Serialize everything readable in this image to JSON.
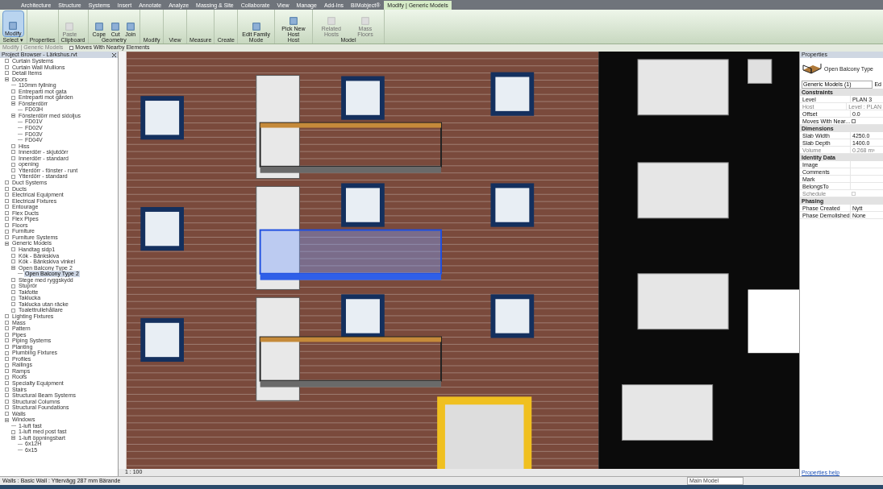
{
  "ribbon_tabs": [
    {
      "label": "Architecture",
      "selected": false
    },
    {
      "label": "Structure",
      "selected": false
    },
    {
      "label": "Systems",
      "selected": false
    },
    {
      "label": "Insert",
      "selected": false
    },
    {
      "label": "Annotate",
      "selected": false
    },
    {
      "label": "Analyze",
      "selected": false
    },
    {
      "label": "Massing & Site",
      "selected": false
    },
    {
      "label": "Collaborate",
      "selected": false
    },
    {
      "label": "View",
      "selected": false
    },
    {
      "label": "Manage",
      "selected": false
    },
    {
      "label": "Add-Ins",
      "selected": false
    },
    {
      "label": "BIMobject®",
      "selected": false
    },
    {
      "label": "Modify | Generic Models",
      "selected": true
    }
  ],
  "ribbon_panels": [
    {
      "label": "Select ▾",
      "tools": [
        {
          "label": "Modify",
          "selected": true,
          "disabled": false
        }
      ]
    },
    {
      "label": "Properties"
    },
    {
      "label": "Clipboard",
      "tools": [
        {
          "label": "Paste",
          "selected": false,
          "disabled": true
        }
      ]
    },
    {
      "label": "Geometry",
      "tools": [
        {
          "label": "Cope",
          "selected": false,
          "disabled": false
        },
        {
          "label": "Cut",
          "selected": false,
          "disabled": false
        },
        {
          "label": "Join",
          "selected": false,
          "disabled": false
        }
      ]
    },
    {
      "label": "Modify"
    },
    {
      "label": "View"
    },
    {
      "label": "Measure"
    },
    {
      "label": "Create"
    },
    {
      "label": "Mode",
      "tools": [
        {
          "label": "Edit Family",
          "selected": false,
          "disabled": false
        }
      ]
    },
    {
      "label": "Host",
      "tools": [
        {
          "label": "Pick New Host",
          "selected": false,
          "disabled": false
        }
      ]
    },
    {
      "label": "Model",
      "tools": [
        {
          "label": "Related Hosts",
          "selected": false,
          "disabled": true
        },
        {
          "label": "Mass Floors",
          "selected": false,
          "disabled": true
        }
      ]
    }
  ],
  "options_bar": {
    "context": "Modify | Generic Models",
    "checkbox": {
      "label": "Moves With Nearby Elements",
      "checked": false
    }
  },
  "project_browser": {
    "title": "Project Browser - Lärkshus.rvt",
    "items": [
      {
        "label": "Curtain Systems",
        "kind": "folder",
        "expanded": false,
        "selected": false
      },
      {
        "label": "Curtain Wall Mullions",
        "kind": "folder",
        "expanded": false,
        "selected": false
      },
      {
        "label": "Detail Items",
        "kind": "folder",
        "expanded": false,
        "selected": false
      },
      {
        "label": "Doors",
        "kind": "folder",
        "expanded": true,
        "selected": false,
        "children": [
          {
            "label": "110mm fyllning",
            "kind": "leaf",
            "selected": false
          },
          {
            "label": "Entreparti mot gata",
            "kind": "folder",
            "expanded": false,
            "selected": false
          },
          {
            "label": "Entreparti mot gården",
            "kind": "folder",
            "expanded": false,
            "selected": false
          },
          {
            "label": "Fönsterdörr",
            "kind": "folder",
            "expanded": true,
            "selected": false,
            "children": [
              {
                "label": "FD03H",
                "kind": "leaf",
                "selected": false
              }
            ]
          },
          {
            "label": "Fönsterdörr med sidoljus",
            "kind": "folder",
            "expanded": true,
            "selected": false,
            "children": [
              {
                "label": "FD01V",
                "kind": "leaf",
                "selected": false
              },
              {
                "label": "FD02V",
                "kind": "leaf",
                "selected": false
              },
              {
                "label": "FD03V",
                "kind": "leaf",
                "selected": false
              },
              {
                "label": "FD04V",
                "kind": "leaf",
                "selected": false
              }
            ]
          },
          {
            "label": "Hiss",
            "kind": "folder",
            "expanded": false,
            "selected": false
          },
          {
            "label": "Innerdörr - skjutdörr",
            "kind": "folder",
            "expanded": false,
            "selected": false
          },
          {
            "label": "Innerdörr - standard",
            "kind": "folder",
            "expanded": false,
            "selected": false
          },
          {
            "label": "opening",
            "kind": "folder",
            "expanded": false,
            "selected": false
          },
          {
            "label": "Ytterdörr - fönster - runt",
            "kind": "folder",
            "expanded": false,
            "selected": false
          },
          {
            "label": "Ytterdörr - standard",
            "kind": "folder",
            "expanded": false,
            "selected": false
          }
        ]
      },
      {
        "label": "Duct Systems",
        "kind": "folder",
        "expanded": false,
        "selected": false
      },
      {
        "label": "Ducts",
        "kind": "folder",
        "expanded": false,
        "selected": false
      },
      {
        "label": "Electrical Equipment",
        "kind": "folder",
        "expanded": false,
        "selected": false
      },
      {
        "label": "Electrical Fixtures",
        "kind": "folder",
        "expanded": false,
        "selected": false
      },
      {
        "label": "Entourage",
        "kind": "folder",
        "expanded": false,
        "selected": false
      },
      {
        "label": "Flex Ducts",
        "kind": "folder",
        "expanded": false,
        "selected": false
      },
      {
        "label": "Flex Pipes",
        "kind": "folder",
        "expanded": false,
        "selected": false
      },
      {
        "label": "Floors",
        "kind": "folder",
        "expanded": false,
        "selected": false
      },
      {
        "label": "Furniture",
        "kind": "folder",
        "expanded": false,
        "selected": false
      },
      {
        "label": "Furniture Systems",
        "kind": "folder",
        "expanded": false,
        "selected": false
      },
      {
        "label": "Generic Models",
        "kind": "folder",
        "expanded": true,
        "selected": false,
        "children": [
          {
            "label": "Handtag sidp1",
            "kind": "folder",
            "expanded": false,
            "selected": false
          },
          {
            "label": "Kök - Bänkskiva",
            "kind": "folder",
            "expanded": false,
            "selected": false
          },
          {
            "label": "Kök - Bänkskiva vinkel",
            "kind": "folder",
            "expanded": false,
            "selected": false
          },
          {
            "label": "Open Balcony Type 2",
            "kind": "folder",
            "expanded": true,
            "selected": false,
            "children": [
              {
                "label": "Open Balcony Type 2",
                "kind": "leaf",
                "selected": true
              }
            ]
          },
          {
            "label": "Stege med ryggskydd",
            "kind": "folder",
            "expanded": false,
            "selected": false
          },
          {
            "label": "Stuprör",
            "kind": "folder",
            "expanded": false,
            "selected": false
          },
          {
            "label": "Takfotte",
            "kind": "folder",
            "expanded": false,
            "selected": false
          },
          {
            "label": "Taklucka",
            "kind": "folder",
            "expanded": false,
            "selected": false
          },
          {
            "label": "Taklucka utan räcke",
            "kind": "folder",
            "expanded": false,
            "selected": false
          },
          {
            "label": "Toalettrullehållare",
            "kind": "folder",
            "expanded": false,
            "selected": false
          }
        ]
      },
      {
        "label": "Lighting Fixtures",
        "kind": "folder",
        "expanded": false,
        "selected": false
      },
      {
        "label": "Mass",
        "kind": "folder",
        "expanded": false,
        "selected": false
      },
      {
        "label": "Pattern",
        "kind": "folder",
        "expanded": false,
        "selected": false
      },
      {
        "label": "Pipes",
        "kind": "folder",
        "expanded": false,
        "selected": false
      },
      {
        "label": "Piping Systems",
        "kind": "folder",
        "expanded": false,
        "selected": false
      },
      {
        "label": "Planting",
        "kind": "folder",
        "expanded": false,
        "selected": false
      },
      {
        "label": "Plumbing Fixtures",
        "kind": "folder",
        "expanded": false,
        "selected": false
      },
      {
        "label": "Profiles",
        "kind": "folder",
        "expanded": false,
        "selected": false
      },
      {
        "label": "Railings",
        "kind": "folder",
        "expanded": false,
        "selected": false
      },
      {
        "label": "Ramps",
        "kind": "folder",
        "expanded": false,
        "selected": false
      },
      {
        "label": "Roofs",
        "kind": "folder",
        "expanded": false,
        "selected": false
      },
      {
        "label": "Specialty Equipment",
        "kind": "folder",
        "expanded": false,
        "selected": false
      },
      {
        "label": "Stairs",
        "kind": "folder",
        "expanded": false,
        "selected": false
      },
      {
        "label": "Structural Beam Systems",
        "kind": "folder",
        "expanded": false,
        "selected": false
      },
      {
        "label": "Structural Columns",
        "kind": "folder",
        "expanded": false,
        "selected": false
      },
      {
        "label": "Structural Foundations",
        "kind": "folder",
        "expanded": false,
        "selected": false
      },
      {
        "label": "Walls",
        "kind": "folder",
        "expanded": false,
        "selected": false
      },
      {
        "label": "Windows",
        "kind": "folder",
        "expanded": true,
        "selected": false,
        "children": [
          {
            "label": "1-luft fast",
            "kind": "leaf",
            "selected": false
          },
          {
            "label": "1-luft med post fast",
            "kind": "folder",
            "expanded": false,
            "selected": false
          },
          {
            "label": "1-luft öppningsbart",
            "kind": "folder",
            "expanded": true,
            "selected": false,
            "children": [
              {
                "label": "6x12H",
                "kind": "leaf",
                "selected": false
              },
              {
                "label": "6x15",
                "kind": "leaf",
                "selected": false
              }
            ]
          }
        ]
      }
    ]
  },
  "view": {
    "scale": "1 : 100"
  },
  "properties": {
    "title": "Properties",
    "type_name": "Open Balcony Type",
    "selector": "Generic Models (1)",
    "edit_type": "Ed",
    "sections": [
      {
        "title": "Constraints",
        "rows": [
          {
            "label": "Level",
            "value": "PLAN 3",
            "kind": "text",
            "disabled": false
          },
          {
            "label": "Host",
            "value": "Level : PLAN",
            "kind": "text",
            "disabled": true
          },
          {
            "label": "Offset",
            "value": "0.0",
            "kind": "text",
            "disabled": false
          },
          {
            "label": "Moves With Near...",
            "kind": "checkbox",
            "checked": false,
            "disabled": false
          }
        ]
      },
      {
        "title": "Dimensions",
        "rows": [
          {
            "label": "Slab Width",
            "value": "4250.0",
            "kind": "text",
            "disabled": false
          },
          {
            "label": "Slab Depth",
            "value": "1400.0",
            "kind": "text",
            "disabled": false
          },
          {
            "label": "Volume",
            "value": "0.268 m³",
            "kind": "text",
            "disabled": true
          }
        ]
      },
      {
        "title": "Identity Data",
        "rows": [
          {
            "label": "Image",
            "kind": "text",
            "disabled": false
          },
          {
            "label": "Comments",
            "kind": "text",
            "disabled": false
          },
          {
            "label": "Mark",
            "kind": "text",
            "disabled": false
          },
          {
            "label": "BelongsTo",
            "kind": "text",
            "disabled": false
          },
          {
            "label": "Schedule",
            "kind": "checkbox",
            "checked": false,
            "disabled": true
          }
        ]
      },
      {
        "title": "Phasing",
        "rows": [
          {
            "label": "Phase Created",
            "value": "Nytt",
            "kind": "text",
            "disabled": false
          },
          {
            "label": "Phase Demolished",
            "value": "None",
            "kind": "text",
            "disabled": false
          }
        ]
      }
    ],
    "help_link": "Properties help"
  },
  "status_bar": {
    "message": "Walls : Basic Wall : Yttervägg 287 mm Bärande",
    "model": "Main Model"
  }
}
